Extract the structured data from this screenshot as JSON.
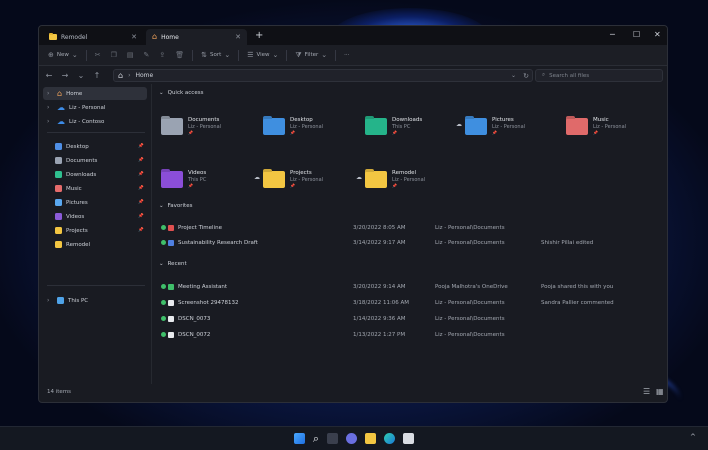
{
  "tabs": [
    {
      "label": "Remodel"
    },
    {
      "label": "Home"
    }
  ],
  "window_controls": {
    "minimize": "─",
    "maximize": "☐",
    "close": "✕"
  },
  "toolbar": {
    "new": "New",
    "sort": "Sort",
    "view": "View",
    "filter": "Filter",
    "more": "···"
  },
  "address": {
    "path": "Home",
    "search_placeholder": "Search all files"
  },
  "sidebar": {
    "top": [
      {
        "label": "Home"
      },
      {
        "label": "Liz - Personal"
      },
      {
        "label": "Liz - Contoso"
      }
    ],
    "pinned": [
      {
        "label": "Desktop",
        "color": "#4f8fe6"
      },
      {
        "label": "Documents",
        "color": "#9aa3b2"
      },
      {
        "label": "Downloads",
        "color": "#2fbf8f"
      },
      {
        "label": "Music",
        "color": "#e56b6b"
      },
      {
        "label": "Pictures",
        "color": "#5aa8f0"
      },
      {
        "label": "Videos",
        "color": "#8b5bd8"
      },
      {
        "label": "Projects",
        "color": "#f3c642"
      },
      {
        "label": "Remodel",
        "color": "#f3c642"
      }
    ],
    "this_pc": "This PC"
  },
  "quick_access": {
    "title": "Quick access",
    "tiles": [
      {
        "name": "Documents",
        "sub": "Liz - Personal",
        "color": "#9aa3b2"
      },
      {
        "name": "Desktop",
        "sub": "Liz - Personal",
        "color": "#3f8fe0"
      },
      {
        "name": "Downloads",
        "sub": "This PC",
        "color": "#25b48a"
      },
      {
        "name": "Pictures",
        "sub": "Liz - Personal",
        "color": "#3f8fe0"
      },
      {
        "name": "Music",
        "sub": "Liz - Personal",
        "color": "#e06a6a"
      },
      {
        "name": "Videos",
        "sub": "This PC",
        "color": "#8b4ed8"
      },
      {
        "name": "Projects",
        "sub": "Liz - Personal",
        "color": "#f3c642"
      },
      {
        "name": "Remodel",
        "sub": "Liz - Personal",
        "color": "#f3c642"
      }
    ]
  },
  "favorites": {
    "title": "Favorites",
    "rows": [
      {
        "name": "Project Timeline",
        "date": "3/20/2022 8:05 AM",
        "location": "Liz - Personal\\Documents",
        "activity": ""
      },
      {
        "name": "Sustainability Research Draft",
        "date": "3/14/2022 9:17 AM",
        "location": "Liz - Personal\\Documents",
        "activity": "Shishir Pillai edited"
      }
    ]
  },
  "recent": {
    "title": "Recent",
    "rows": [
      {
        "name": "Meeting Assistant",
        "date": "3/20/2022 9:14 AM",
        "location": "Pooja Malhotra's OneDrive",
        "activity": "Pooja shared this with you"
      },
      {
        "name": "Screenshot 29478132",
        "date": "3/18/2022 11:06 AM",
        "location": "Liz - Personal\\Documents",
        "activity": "Sandra Pallier commented"
      },
      {
        "name": "DSCN_0073",
        "date": "1/14/2022 9:36 AM",
        "location": "Liz - Personal\\Documents",
        "activity": ""
      },
      {
        "name": "DSCN_0072",
        "date": "1/13/2022 1:27 PM",
        "location": "Liz - Personal\\Documents",
        "activity": ""
      }
    ]
  },
  "status": {
    "items": "14 items"
  }
}
